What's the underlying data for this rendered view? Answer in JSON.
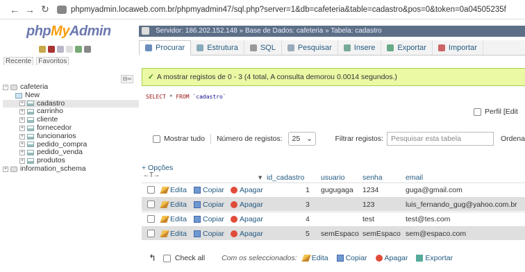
{
  "browser": {
    "url": "phpmyadmin.locaweb.com.br/phpmyadmin47/sql.php?server=1&db=cafeteria&table=cadastro&pos=0&token=0a04505235f"
  },
  "sidebar": {
    "logo_php": "php",
    "logo_my": "My",
    "logo_admin": "Admin",
    "recent_tab": "Recente",
    "favorites_tab": "Favoritos",
    "db_name": "cafeteria",
    "new_item": "New",
    "tables": [
      "cadastro",
      "carrinho",
      "cliente",
      "fornecedor",
      "funcionarios",
      "pedido_compra",
      "pedido_venda",
      "produtos"
    ],
    "selected_table": "cadastro",
    "other_db": "information_schema"
  },
  "breadcrumb": {
    "server": "Servidor: 186.202.152.148",
    "database": "Base de Dados: cafeteria",
    "table": "Tabela: cadastro"
  },
  "tabs": [
    {
      "label": "Procurar",
      "icon": "browse-icon",
      "color": "#6a8fbd"
    },
    {
      "label": "Estrutura",
      "icon": "structure-icon",
      "color": "#8ab"
    },
    {
      "label": "SQL",
      "icon": "sql-icon",
      "color": "#999"
    },
    {
      "label": "Pesquisar",
      "icon": "search-icon",
      "color": "#9ab"
    },
    {
      "label": "Insere",
      "icon": "insert-icon",
      "color": "#7a9"
    },
    {
      "label": "Exportar",
      "icon": "export-icon",
      "color": "#6a8"
    },
    {
      "label": "Importar",
      "icon": "import-icon",
      "color": "#c66"
    }
  ],
  "message": "A mostrar registos de 0 - 3 (4 total, A consulta demorou 0.0014 segundos.)",
  "sql_query": {
    "select": "SELECT",
    "star": " * ",
    "from": "FROM",
    "table": " `cadastro`"
  },
  "perfil": "Perfil [Edit",
  "filters": {
    "show_all": "Mostrar tudo",
    "num_rows_label": "Número de registos:",
    "num_rows_value": "25",
    "filter_label": "Filtrar registos:",
    "filter_placeholder": "Pesquisar esta tabela",
    "sort_label": "Ordenar"
  },
  "options_label": "+ Opções",
  "columns": [
    "id_cadastro",
    "usuario",
    "senha",
    "email"
  ],
  "actions": {
    "edit": "Edita",
    "copy": "Copiar",
    "delete": "Apagar"
  },
  "rows": [
    {
      "id": "1",
      "usuario": "gugugaga",
      "senha": "1234",
      "email": "guga@gmail.com"
    },
    {
      "id": "3",
      "usuario": "",
      "senha": "123",
      "email": "luis_fernando_gug@yahoo.com.br"
    },
    {
      "id": "4",
      "usuario": "",
      "senha": "test",
      "email": "test@tes.com"
    },
    {
      "id": "5",
      "usuario": "semEspaco",
      "senha": "semEspaco",
      "email": "sem@espaco.com"
    }
  ],
  "footer": {
    "check_all": "Check all",
    "with_selected": "Com os seleccionados:",
    "edit": "Edita",
    "copy": "Copiar",
    "delete": "Apagar",
    "export": "Exportar"
  },
  "colors": {
    "link": "#235a81",
    "success_bg": "#ebf8a4",
    "breadcrumb_bg": "#5c6f86"
  }
}
